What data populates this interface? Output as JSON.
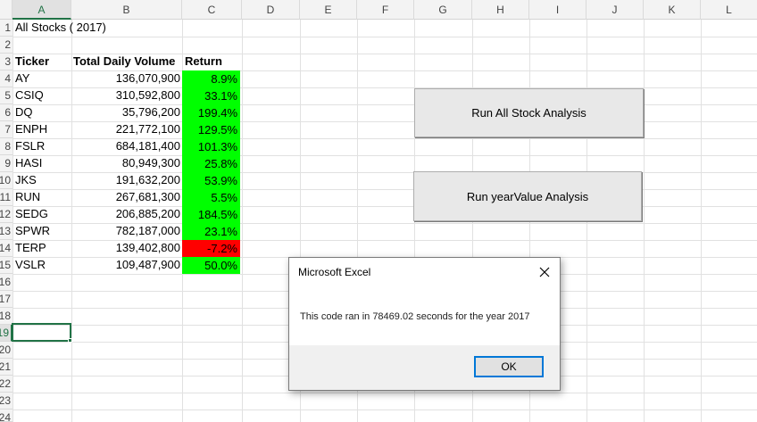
{
  "columns": [
    "A",
    "B",
    "C",
    "D",
    "E",
    "F",
    "G",
    "H",
    "I",
    "J",
    "K",
    "L"
  ],
  "rows": [
    "1",
    "2",
    "3",
    "4",
    "5",
    "6",
    "7",
    "8",
    "9",
    "10",
    "11",
    "12",
    "13",
    "14",
    "15",
    "16",
    "17",
    "18",
    "19",
    "20",
    "21",
    "22",
    "23",
    "24"
  ],
  "sheet": {
    "title": "All Stocks ( 2017)",
    "headers": {
      "ticker": "Ticker",
      "volume": "Total Daily Volume",
      "return": "Return"
    },
    "stocks": [
      {
        "ticker": "AY",
        "volume": "136,070,900",
        "return": "8.9%",
        "status": "positive"
      },
      {
        "ticker": "CSIQ",
        "volume": "310,592,800",
        "return": "33.1%",
        "status": "positive"
      },
      {
        "ticker": "DQ",
        "volume": "35,796,200",
        "return": "199.4%",
        "status": "positive"
      },
      {
        "ticker": "ENPH",
        "volume": "221,772,100",
        "return": "129.5%",
        "status": "positive"
      },
      {
        "ticker": "FSLR",
        "volume": "684,181,400",
        "return": "101.3%",
        "status": "positive"
      },
      {
        "ticker": "HASI",
        "volume": "80,949,300",
        "return": "25.8%",
        "status": "positive"
      },
      {
        "ticker": "JKS",
        "volume": "191,632,200",
        "return": "53.9%",
        "status": "positive"
      },
      {
        "ticker": "RUN",
        "volume": "267,681,300",
        "return": "5.5%",
        "status": "positive"
      },
      {
        "ticker": "SEDG",
        "volume": "206,885,200",
        "return": "184.5%",
        "status": "positive"
      },
      {
        "ticker": "SPWR",
        "volume": "782,187,000",
        "return": "23.1%",
        "status": "positive"
      },
      {
        "ticker": "TERP",
        "volume": "139,402,800",
        "return": "-7.2%",
        "status": "negative"
      },
      {
        "ticker": "VSLR",
        "volume": "109,487,900",
        "return": "50.0%",
        "status": "positive"
      }
    ]
  },
  "buttons": {
    "run_all": "Run All Stock Analysis",
    "run_year": "Run yearValue Analysis"
  },
  "dialog": {
    "title": "Microsoft Excel",
    "message": "This code ran in 78469.02 seconds for the year 2017",
    "ok": "OK",
    "close_icon": "close-icon"
  },
  "colors": {
    "positive": "#00ff00",
    "negative": "#ff0000",
    "selection": "#217346"
  }
}
